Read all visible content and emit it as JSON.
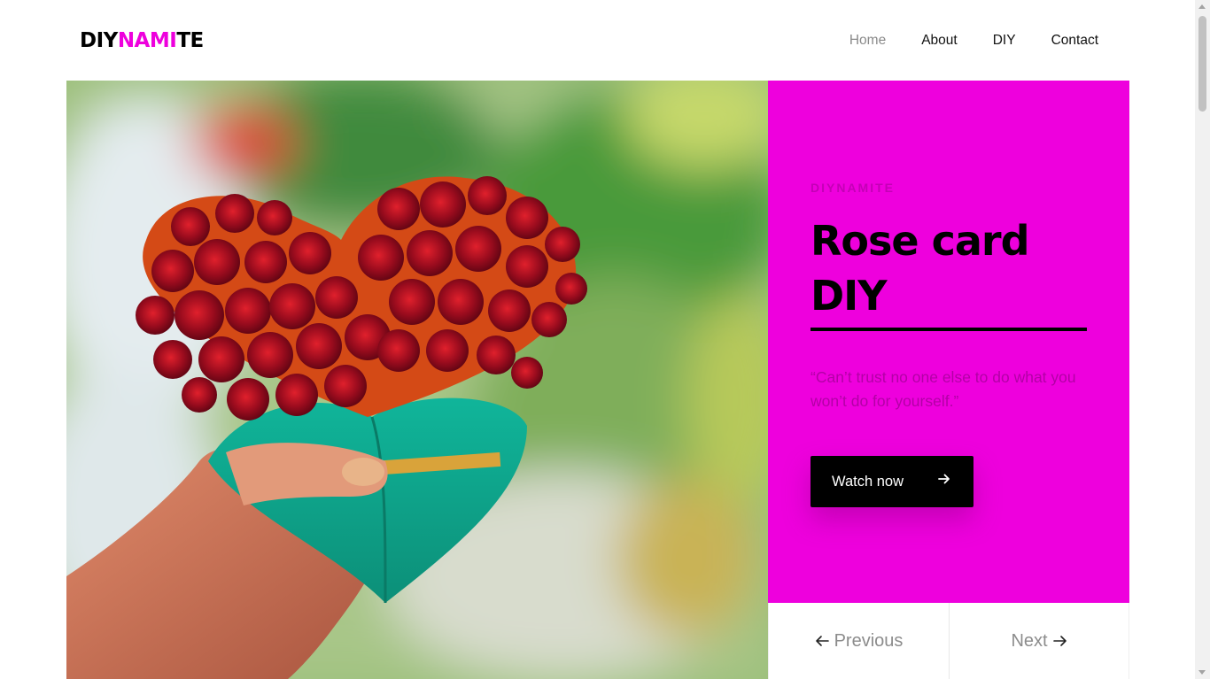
{
  "brand": {
    "logo_part1": "DIY",
    "logo_part2": "NAMI",
    "logo_part3": "TE",
    "accent_color": "#ee00dd"
  },
  "nav": {
    "items": [
      {
        "label": "Home",
        "active": true
      },
      {
        "label": "About",
        "active": false
      },
      {
        "label": "DIY",
        "active": false
      },
      {
        "label": "Contact",
        "active": false
      }
    ]
  },
  "hero": {
    "eyebrow": "DIYNAMITE",
    "title": "Rose card DIY",
    "quote": "“Can’t trust no one else to do what you won’t do for yourself.”",
    "cta_label": "Watch now",
    "cta_icon": "arrow-right-icon",
    "panel_color": "#ee00dd",
    "image_subject": "hand-holding-paper-rose-heart-card"
  },
  "pager": {
    "previous_label": "Previous",
    "next_label": "Next"
  }
}
